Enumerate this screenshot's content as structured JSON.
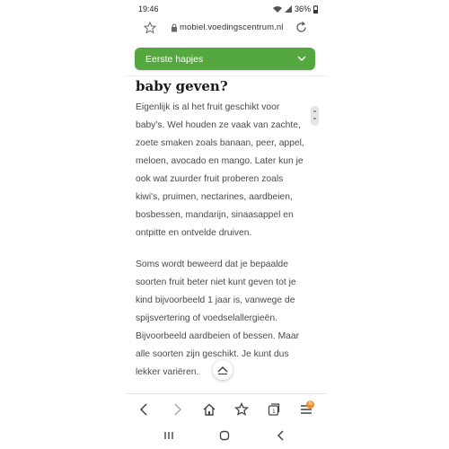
{
  "status": {
    "time": "19:46",
    "battery": "36%"
  },
  "browser": {
    "url": "mobiel.voedingscentrum.nl"
  },
  "dropdown": {
    "label": "Eerste hapjes"
  },
  "article": {
    "heading": "baby geven?",
    "paragraph1": [
      "Eigenlijk is al het fruit geschikt voor",
      "baby's. Wel houden ze vaak van zachte,",
      "zoete smaken zoals banaan, peer, appel,",
      "meloen, avocado en mango. Later kun je",
      "ook wat zuurder fruit proberen zoals",
      "kiwi's, pruimen, nectarines, aardbeien,",
      "bosbessen, mandarijn, sinaasappel en",
      "ontpitte en ontvelde druiven."
    ],
    "paragraph2": [
      "Soms wordt beweerd dat je bepaalde",
      "soorten fruit beter niet kunt geven tot je",
      "kind bijvoorbeeld 1 jaar is, vanwege de",
      "spijsvertering of voedselallergieën.",
      "Bijvoorbeeld aardbeien of bessen. Maar",
      "alle soorten zijn geschikt. Je kunt dus",
      "lekker variëren."
    ]
  },
  "toolbar": {
    "menu_badge": "N"
  },
  "colors": {
    "accent": "#54a83f",
    "badge": "#f08a24"
  }
}
